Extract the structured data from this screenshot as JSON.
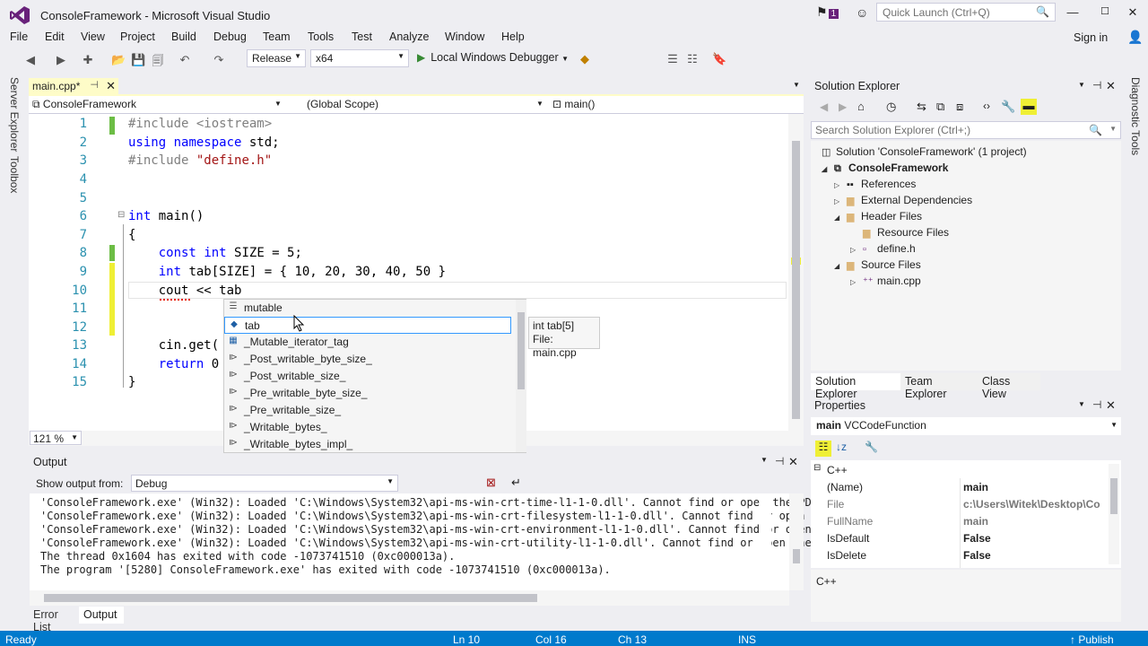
{
  "window": {
    "title": "ConsoleFramework - Microsoft Visual Studio",
    "notification_count": "1",
    "quick_launch_placeholder": "Quick Launch (Ctrl+Q)"
  },
  "menu": [
    "File",
    "Edit",
    "View",
    "Project",
    "Build",
    "Debug",
    "Team",
    "Tools",
    "Test",
    "Analyze",
    "Window",
    "Help"
  ],
  "sign_in": "Sign in",
  "toolbar": {
    "configuration": "Release",
    "platform": "x64",
    "debugger": "Local Windows Debugger"
  },
  "side_tabs": [
    "Server Explorer",
    "Toolbox"
  ],
  "right_side_tab": "Diagnostic Tools",
  "editor": {
    "tab": "main.cpp*",
    "nav": {
      "project": "ConsoleFramework",
      "scope": "(Global Scope)",
      "member": "main()"
    },
    "line_numbers": [
      "1",
      "2",
      "3",
      "4",
      "5",
      "6",
      "7",
      "8",
      "9",
      "10",
      "11",
      "12",
      "13",
      "14",
      "15"
    ],
    "lines": [
      {
        "t": "#include <iostream>"
      },
      {
        "t": "using namespace std;"
      },
      {
        "t": "#include \"define.h\""
      },
      {
        "t": ""
      },
      {
        "t": ""
      },
      {
        "t": "int main()"
      },
      {
        "t": "{"
      },
      {
        "t": "    const int SIZE = 5;"
      },
      {
        "t": "    int tab[SIZE] = { 10, 20, 30, 40, 50 }"
      },
      {
        "t": "    cout << tab"
      },
      {
        "t": ""
      },
      {
        "t": ""
      },
      {
        "t": "    cin.get("
      },
      {
        "t": "    return 0"
      },
      {
        "t": "}"
      }
    ],
    "zoom": "121 %"
  },
  "completion": {
    "items": [
      "mutable",
      "tab",
      "_Mutable_iterator_tag",
      "_Post_writable_byte_size_",
      "_Post_writable_size_",
      "_Pre_writable_byte_size_",
      "_Pre_writable_size_",
      "_Writable_bytes_",
      "_Writable_bytes_impl_"
    ],
    "selected": "tab"
  },
  "tooltip": {
    "line1": "int tab[5]",
    "line2": "File: main.cpp"
  },
  "output": {
    "title": "Output",
    "show_from_label": "Show output from:",
    "source": "Debug",
    "lines": [
      "'ConsoleFramework.exe' (Win32): Loaded 'C:\\Windows\\System32\\api-ms-win-crt-time-l1-1-0.dll'. Cannot find or open the PD",
      "'ConsoleFramework.exe' (Win32): Loaded 'C:\\Windows\\System32\\api-ms-win-crt-filesystem-l1-1-0.dll'. Cannot find or open",
      "'ConsoleFramework.exe' (Win32): Loaded 'C:\\Windows\\System32\\api-ms-win-crt-environment-l1-1-0.dll'. Cannot find or open",
      "'ConsoleFramework.exe' (Win32): Loaded 'C:\\Windows\\System32\\api-ms-win-crt-utility-l1-1-0.dll'. Cannot find or open the",
      "The thread 0x1604 has exited with code -1073741510 (0xc000013a).",
      "The program '[5280] ConsoleFramework.exe' has exited with code -1073741510 (0xc000013a)."
    ],
    "tabs": [
      "Error List",
      "Output"
    ]
  },
  "solution_explorer": {
    "title": "Solution Explorer",
    "search_placeholder": "Search Solution Explorer (Ctrl+;)",
    "tree": [
      "Solution 'ConsoleFramework' (1 project)",
      "ConsoleFramework",
      "References",
      "External Dependencies",
      "Header Files",
      "Resource Files",
      "define.h",
      "Source Files",
      "main.cpp"
    ],
    "tabs": [
      "Solution Explorer",
      "Team Explorer",
      "Class View"
    ]
  },
  "properties": {
    "title": "Properties",
    "object_name": "main",
    "object_type": "VCCodeFunction",
    "category": "C++",
    "rows": [
      {
        "name": "(Name)",
        "value": "main"
      },
      {
        "name": "File",
        "value": "c:\\Users\\Witek\\Desktop\\Co"
      },
      {
        "name": "FullName",
        "value": "main"
      },
      {
        "name": "IsDefault",
        "value": "False"
      },
      {
        "name": "IsDelete",
        "value": "False"
      }
    ],
    "description": "C++"
  },
  "status": {
    "ready": "Ready",
    "ln": "Ln 10",
    "col": "Col 16",
    "ch": "Ch 13",
    "ins": "INS",
    "publish": "Publish"
  },
  "colors": {
    "accent": "#007acc",
    "brand": "#68217a",
    "keyword": "#0000ff",
    "preprocessor": "#808080",
    "string": "#a31515",
    "line_number": "#2b91af"
  }
}
